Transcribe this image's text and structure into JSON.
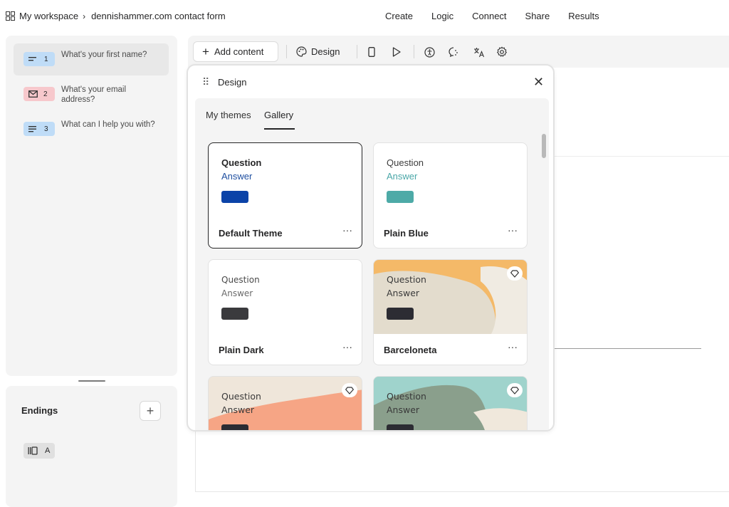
{
  "breadcrumb": {
    "workspace": "My workspace",
    "separator": "›",
    "form_name": "dennishammer.com contact form"
  },
  "topnav": [
    "Create",
    "Logic",
    "Connect",
    "Share",
    "Results"
  ],
  "questions": [
    {
      "num": "1",
      "text": "What's your first name?",
      "icon": "short-text-icon",
      "color": "#bfdcf7"
    },
    {
      "num": "2",
      "text": "What's your email address?",
      "icon": "envelope-icon",
      "color": "#f7c8cc"
    },
    {
      "num": "3",
      "text": "What can I help you with?",
      "icon": "long-text-icon",
      "color": "#bfdcf7"
    }
  ],
  "endings": {
    "label": "Endings",
    "add": "+",
    "items": [
      {
        "letter": "A",
        "icon": "ending-icon"
      }
    ]
  },
  "toolbar": {
    "add_content": "Add content",
    "design": "Design"
  },
  "design_panel": {
    "title": "Design",
    "tabs": [
      "My themes",
      "Gallery"
    ],
    "active_tab": "Gallery",
    "themes": [
      {
        "name": "Default Theme",
        "question": "Question",
        "answer": "Answer",
        "selected": true,
        "premium": false,
        "q_color": "#262627",
        "a_color": "#1f4fa0",
        "swatch": "#0b43a8"
      },
      {
        "name": "Plain Blue",
        "question": "Question",
        "answer": "Answer",
        "selected": false,
        "premium": false,
        "q_color": "#3d3d3d",
        "a_color": "#4aa7a8",
        "swatch": "#4daaa7"
      },
      {
        "name": "Plain Dark",
        "question": "Question",
        "answer": "Answer",
        "selected": false,
        "premium": false,
        "q_color": "#4a4a4a",
        "a_color": "#6a6a6a",
        "swatch": "#3a3a3d"
      },
      {
        "name": "Barceloneta",
        "question": "Question",
        "answer": "Answer",
        "selected": false,
        "premium": true,
        "q_color": "#3a3a3a",
        "a_color": "#3a3a3a",
        "swatch": "#2c2c33"
      },
      {
        "name": "",
        "question": "Question",
        "answer": "Answer",
        "selected": false,
        "premium": true,
        "q_color": "#3a3a3a",
        "a_color": "#3a3a3a",
        "swatch": "#2c2c33"
      },
      {
        "name": "",
        "question": "Question",
        "answer": "Answer",
        "selected": false,
        "premium": true,
        "q_color": "#3a3a3a",
        "a_color": "#3a3a3a",
        "swatch": "#2c2c33"
      }
    ]
  }
}
